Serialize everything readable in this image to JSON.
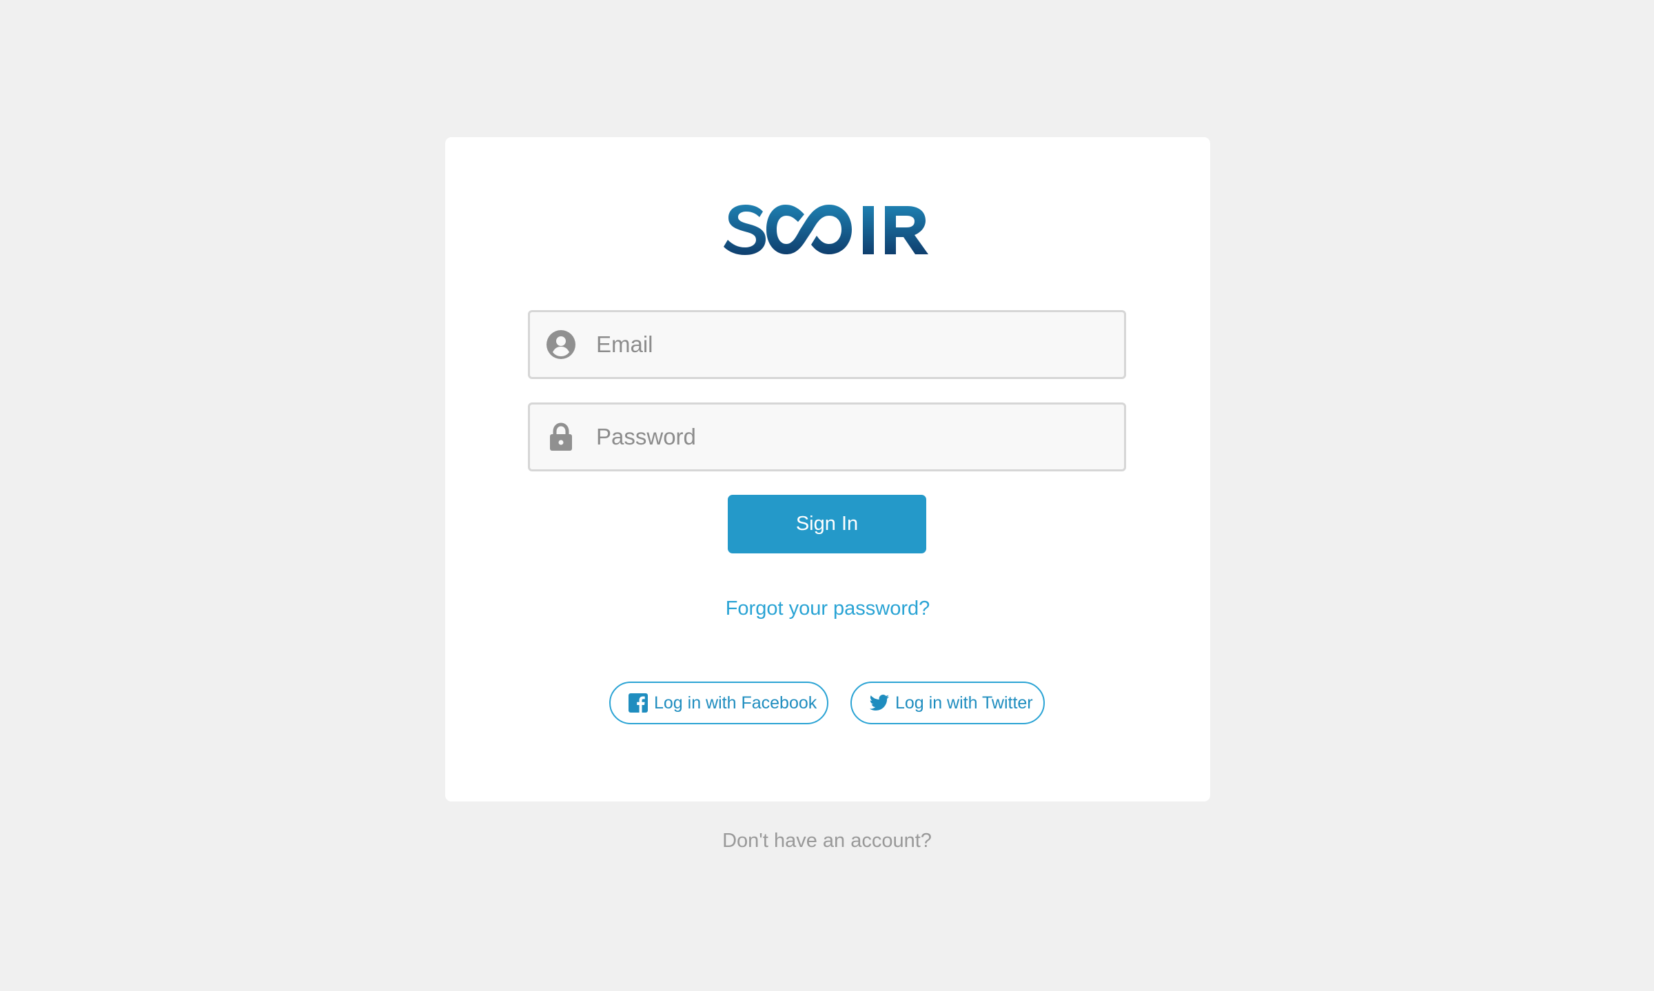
{
  "brand": {
    "logo_text": "SCOIR",
    "colors": {
      "logo_light": "#1e7fb0",
      "logo_dark": "#0f3f6e",
      "accent": "#2499c9",
      "link": "#29a3d4"
    }
  },
  "login_form": {
    "email": {
      "placeholder": "Email",
      "value": "",
      "icon": "user-circle-icon"
    },
    "password": {
      "placeholder": "Password",
      "value": "",
      "icon": "lock-icon"
    },
    "sign_in_label": "Sign In",
    "forgot_label": "Forgot your password?"
  },
  "social_login": {
    "facebook_label": "Log in with Facebook",
    "facebook_icon": "facebook-icon",
    "twitter_label": "Log in with Twitter",
    "twitter_icon": "twitter-icon"
  },
  "footer": {
    "signup_prompt": "Don't have an account?"
  }
}
